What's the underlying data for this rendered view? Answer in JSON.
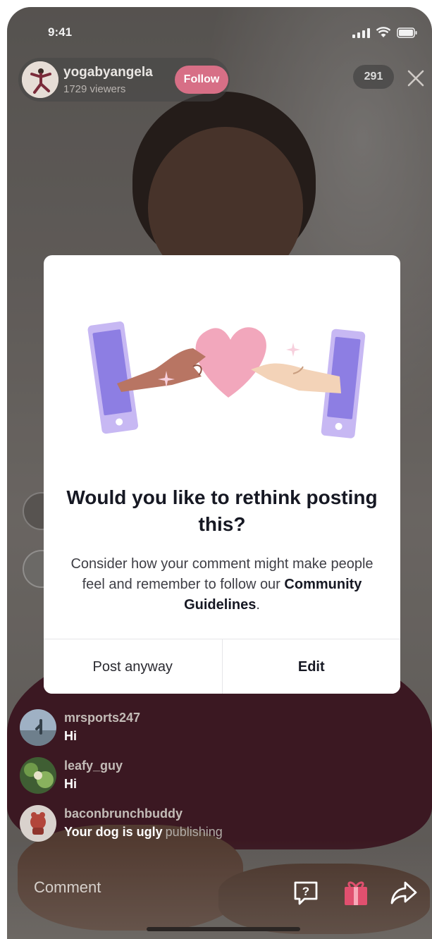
{
  "status_bar": {
    "time": "9:41"
  },
  "host": {
    "username": "yogabyangela",
    "viewers": "1729 viewers",
    "follow_label": "Follow"
  },
  "viewer_count": "291",
  "dialog": {
    "title": "Would you like to rethink posting this?",
    "body_prefix": "Consider how your comment might make people feel and remember to follow our ",
    "body_link": "Community Guidelines",
    "body_suffix": ".",
    "post_anyway_label": "Post anyway",
    "edit_label": "Edit"
  },
  "comments": [
    {
      "user": "mrsports247",
      "text": "Hi",
      "status": ""
    },
    {
      "user": "leafy_guy",
      "text": "Hi",
      "status": ""
    },
    {
      "user": "baconbrunchbuddy",
      "text": "Your dog is ugly",
      "status": "publishing"
    }
  ],
  "comment_bar": {
    "placeholder": "Comment"
  },
  "icons": [
    "signal-icon",
    "wifi-icon",
    "battery-icon",
    "close-icon",
    "question-icon",
    "gift-icon",
    "share-icon"
  ],
  "colors": {
    "follow": "#d76f86",
    "gift": "#e0506f",
    "heart": "#f2a7bc",
    "phone_screen": "#8d7ee3"
  }
}
